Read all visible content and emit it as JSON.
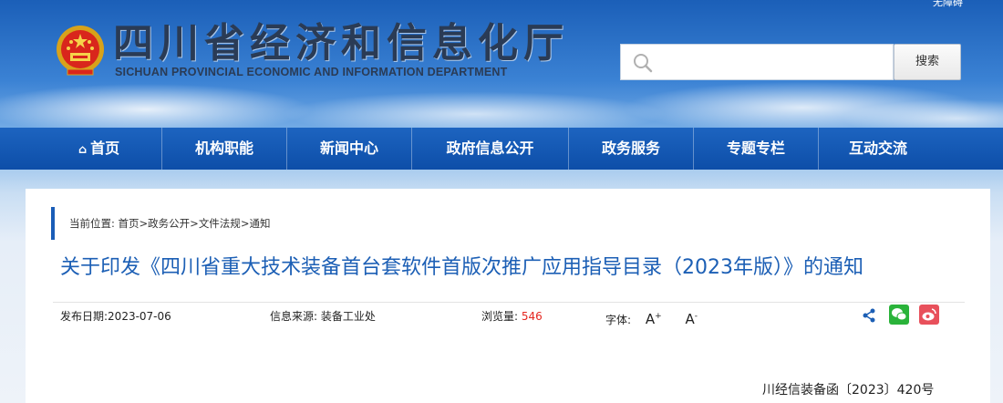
{
  "header": {
    "top_right_text": "无障碍",
    "site_title": "四川省经济和信息化厅",
    "site_subtitle": "SICHUAN PROVINCIAL ECONOMIC AND INFORMATION DEPARTMENT",
    "search": {
      "placeholder": "",
      "button_label": "搜索"
    }
  },
  "nav": {
    "items": [
      {
        "label": "首页",
        "icon": "home-icon"
      },
      {
        "label": "机构职能"
      },
      {
        "label": "新闻中心"
      },
      {
        "label": "政府信息公开"
      },
      {
        "label": "政务服务"
      },
      {
        "label": "专题专栏"
      },
      {
        "label": "互动交流"
      }
    ]
  },
  "breadcrumb": {
    "prefix": "当前位置: ",
    "items": [
      "首页",
      "政务公开",
      "文件法规",
      "通知"
    ],
    "separator": ">"
  },
  "article": {
    "title": "关于印发《四川省重大技术装备首台套软件首版次推广应用指导目录（2023年版）》的通知",
    "publish_label": "发布日期:",
    "publish_date": "2023-07-06",
    "source_label": "信息来源: ",
    "source": "装备工业处",
    "views_label": "浏览量: ",
    "views": "546",
    "font_label": "字体:",
    "font_increase": "A",
    "font_increase_sign": "+",
    "font_decrease": "A",
    "font_decrease_sign": "-",
    "doc_number": "川经信装备函〔2023〕420号"
  },
  "share": {
    "icons": [
      "share-icon",
      "wechat-icon",
      "weibo-icon"
    ]
  },
  "colors": {
    "nav_bg": "#0d4ea8",
    "title_blue": "#1c5fb5",
    "views_red": "#e5261f",
    "wechat_green": "#2ab33a",
    "weibo_red": "#e8505b"
  }
}
